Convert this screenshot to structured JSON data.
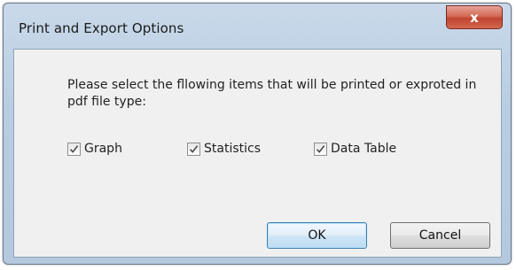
{
  "window": {
    "title": "Print and Export Options",
    "close_symbol": "x"
  },
  "dialog": {
    "message": "Please select the fllowing items that will be printed or exproted in pdf file type:",
    "options": [
      {
        "label": "Graph",
        "checked": true
      },
      {
        "label": "Statistics",
        "checked": true
      },
      {
        "label": "Data Table",
        "checked": true
      }
    ],
    "buttons": {
      "ok": "OK",
      "cancel": "Cancel"
    }
  },
  "icons": {
    "close": "close-icon",
    "check": "checkmark-icon"
  },
  "colors": {
    "title_bar": "#b9cde2",
    "close_button": "#c14530",
    "ok_border": "#3c7fb1"
  }
}
